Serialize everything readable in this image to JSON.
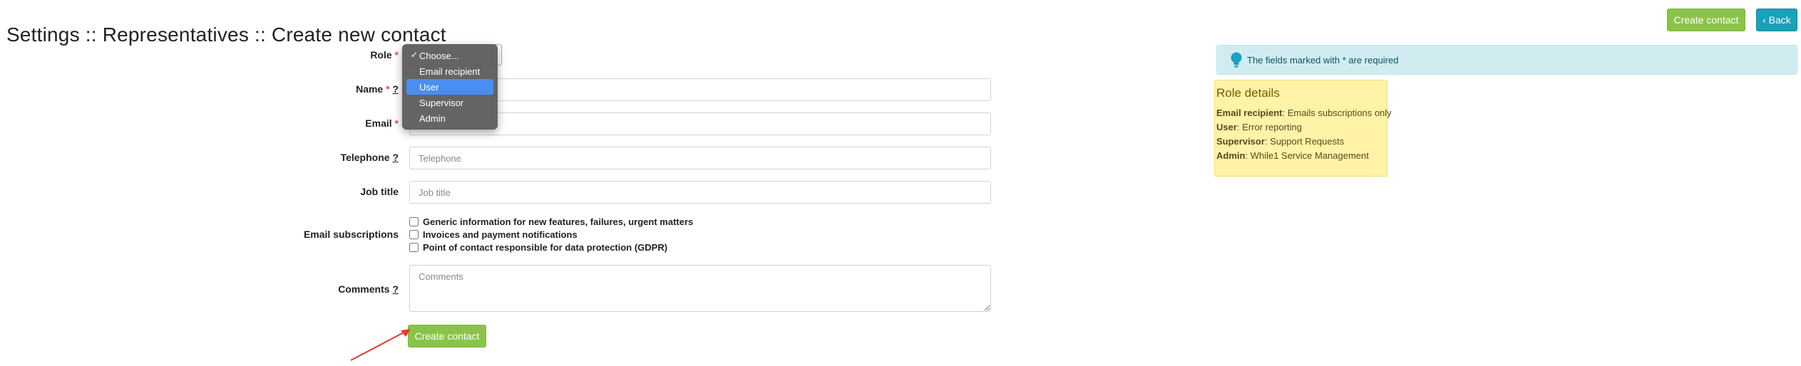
{
  "page": {
    "title": "Settings :: Representatives :: Create new contact"
  },
  "header": {
    "create_label": "Create contact",
    "back_label": "Back"
  },
  "form": {
    "role": {
      "label": "Role",
      "required_mark": "*"
    },
    "name": {
      "label": "Name",
      "required_mark": "*",
      "help": "?"
    },
    "email": {
      "label": "Email",
      "required_mark": "*"
    },
    "telephone": {
      "label": "Telephone",
      "help": "?",
      "placeholder": "Telephone"
    },
    "job_title": {
      "label": "Job title",
      "placeholder": "Job title"
    },
    "subscriptions": {
      "label": "Email subscriptions",
      "options": [
        "Generic information for new features, failures, urgent matters",
        "Invoices and payment notifications",
        "Point of contact responsible for data protection (GDPR)"
      ]
    },
    "comments": {
      "label": "Comments",
      "help": "?",
      "placeholder": "Comments"
    },
    "submit_label": "Create contact"
  },
  "role_dropdown": {
    "options": [
      "Choose...",
      "Email recipient",
      "User",
      "Supervisor",
      "Admin"
    ],
    "checked": "Choose...",
    "highlighted": "User"
  },
  "info_box": {
    "prefix": "The fields marked with",
    "star": "*",
    "suffix": "are required"
  },
  "role_details": {
    "title": "Role details",
    "items": [
      {
        "name": "Email recipient",
        "desc": "Emails subscriptions only"
      },
      {
        "name": "User",
        "desc": "Error reporting"
      },
      {
        "name": "Supervisor",
        "desc": "Support Requests"
      },
      {
        "name": "Admin",
        "desc": "While1 Service Management"
      }
    ]
  },
  "colors": {
    "green": "#8bc34a",
    "teal": "#17a2b8",
    "info_bg": "#d1ecf1",
    "note_bg": "#fff3a8",
    "arrow": "#e8392b"
  }
}
